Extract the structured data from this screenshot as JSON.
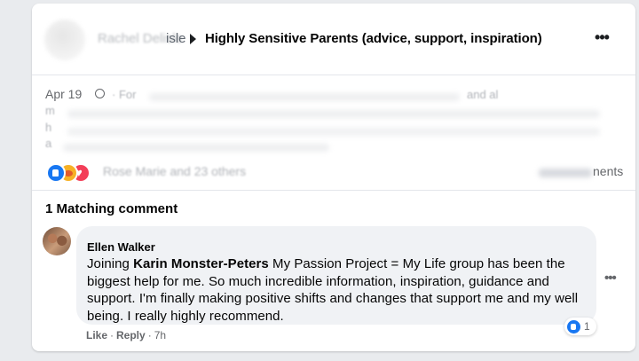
{
  "post": {
    "poster_name": "Rachel Delisle",
    "poster_name_suffix": "isle",
    "group_name": "Highly Sensitive Parents (advice, support, inspiration)",
    "date": "Apr 19",
    "visibility_icon": "globe-icon",
    "body_fragments": [
      "· For",
      "and al",
      "m",
      "h",
      "a"
    ],
    "reactions": {
      "types": [
        "like-reaction-icon",
        "care-reaction-icon",
        "love-reaction-icon"
      ],
      "text": "Rose Marie and 23 others"
    },
    "comments_count": "26 Comments",
    "comments_suffix": "nents",
    "more_icon": "more-options-icon"
  },
  "matching": {
    "title": "1 Matching comment"
  },
  "comment": {
    "author": "Ellen Walker",
    "text_before": "Joining ",
    "mention": "Karin Monster-Peters",
    "text_after": " My Passion Project = My Life group has been the biggest help for me. So much incredible information, inspiration, guidance and support. I'm finally making positive shifts and changes that support me and my well being. I really highly recommend.",
    "like_label": "Like",
    "separator": "·",
    "reply_label": "Reply",
    "time": "7h",
    "reaction_count": "1"
  },
  "colors": {
    "brand_blue": "#1877f2",
    "text_primary": "#050505",
    "text_secondary": "#65676b",
    "bubble_bg": "#f0f2f5"
  }
}
